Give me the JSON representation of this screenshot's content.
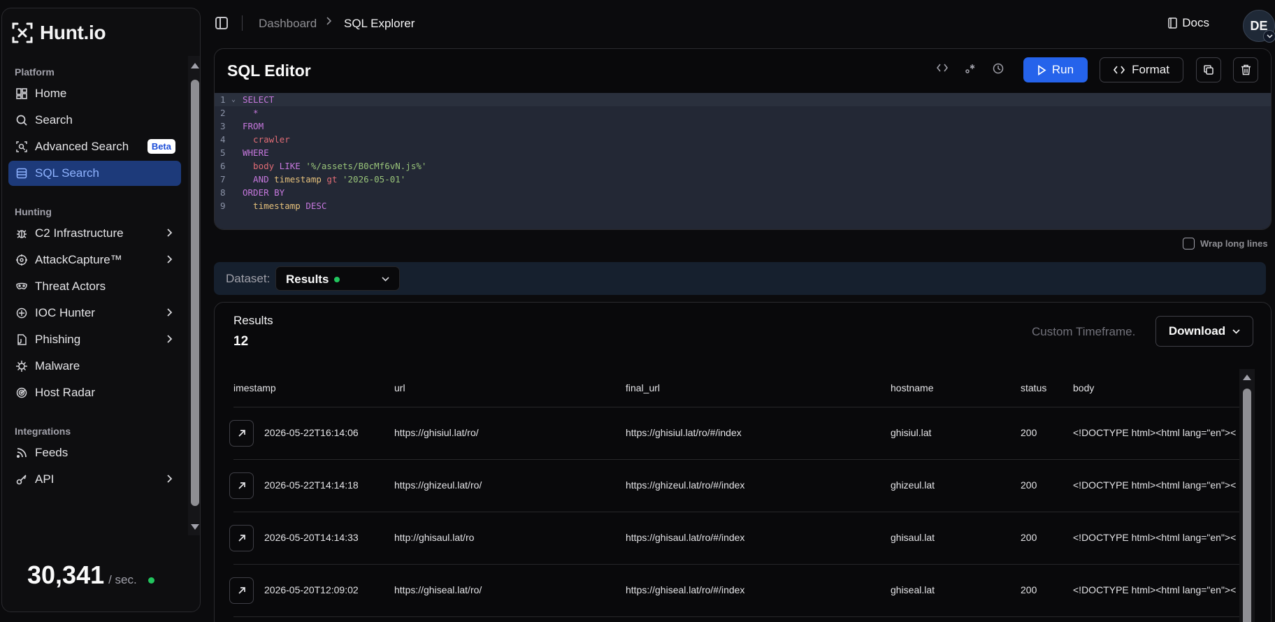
{
  "brand": {
    "name": "Hunt.io"
  },
  "sidebar": {
    "sections": [
      {
        "title": "Platform"
      },
      {
        "title": "Hunting"
      },
      {
        "title": "Integrations"
      }
    ],
    "platform_items": [
      {
        "label": "Home",
        "icon": "dashboard-icon"
      },
      {
        "label": "Search",
        "icon": "search-icon"
      },
      {
        "label": "Advanced Search",
        "icon": "scan-search-icon",
        "badge": "Beta"
      },
      {
        "label": "SQL Search",
        "icon": "database-icon",
        "active": true
      }
    ],
    "hunting_items": [
      {
        "label": "C2 Infrastructure",
        "icon": "bug-icon",
        "has_children": true
      },
      {
        "label": "AttackCapture™",
        "icon": "target-icon",
        "has_children": true
      },
      {
        "label": "Threat Actors",
        "icon": "mask-icon"
      },
      {
        "label": "IOC Hunter",
        "icon": "crosshair-icon",
        "has_children": true
      },
      {
        "label": "Phishing",
        "icon": "file-hook-icon",
        "has_children": true
      },
      {
        "label": "Malware",
        "icon": "virus-icon"
      },
      {
        "label": "Host Radar",
        "icon": "radar-icon"
      }
    ],
    "integration_items": [
      {
        "label": "Feeds",
        "icon": "rss-icon"
      },
      {
        "label": "API",
        "icon": "key-icon",
        "has_children": true
      }
    ],
    "rate": {
      "value": "30,341",
      "unit": "/ sec."
    }
  },
  "topbar": {
    "breadcrumb": [
      "Dashboard",
      "SQL Explorer"
    ],
    "docs_label": "Docs",
    "avatar_initials": "DE"
  },
  "editor": {
    "title": "SQL Editor",
    "run_label": "Run",
    "format_label": "Format",
    "lines": [
      {
        "n": "1",
        "tokens": [
          {
            "t": "SELECT",
            "c": "kw"
          }
        ]
      },
      {
        "n": "2",
        "tokens": [
          {
            "t": "  *",
            "c": "kw"
          }
        ]
      },
      {
        "n": "3",
        "tokens": [
          {
            "t": "FROM",
            "c": "kw"
          }
        ]
      },
      {
        "n": "4",
        "tokens": [
          {
            "t": "  crawler",
            "c": "id"
          }
        ]
      },
      {
        "n": "5",
        "tokens": [
          {
            "t": "WHERE",
            "c": "kw"
          }
        ]
      },
      {
        "n": "6",
        "tokens": [
          {
            "t": "  body",
            "c": "id"
          },
          {
            "t": " LIKE ",
            "c": "kw"
          },
          {
            "t": "'%/assets/B0cMf6vN.js%'",
            "c": "str"
          }
        ]
      },
      {
        "n": "7",
        "tokens": [
          {
            "t": "  AND ",
            "c": "kw"
          },
          {
            "t": "timestamp",
            "c": "tx"
          },
          {
            "t": " gt ",
            "c": "id"
          },
          {
            "t": "'2026-05-01'",
            "c": "str"
          }
        ]
      },
      {
        "n": "8",
        "tokens": [
          {
            "t": "ORDER BY",
            "c": "kw"
          }
        ]
      },
      {
        "n": "9",
        "tokens": [
          {
            "t": "  timestamp",
            "c": "tx"
          },
          {
            "t": " DESC",
            "c": "kw"
          }
        ]
      }
    ],
    "wrap_label": "Wrap long lines"
  },
  "dataset": {
    "label": "Dataset:",
    "value": "Results",
    "status_color": "#22c55e"
  },
  "results": {
    "title": "Results",
    "count": "12",
    "timeframe": "Custom Timeframe.",
    "download_label": "Download",
    "columns": [
      "imestamp",
      "url",
      "final_url",
      "hostname",
      "status",
      "body"
    ],
    "rows": [
      {
        "timestamp": "2026-05-22T16:14:06",
        "url": "https://ghisiul.lat/ro/",
        "final_url": "https://ghisiul.lat/ro/#/index",
        "hostname": "ghisiul.lat",
        "status": "200",
        "body": "<!DOCTYPE html><html lang=\"en\"><"
      },
      {
        "timestamp": "2026-05-22T14:14:18",
        "url": "https://ghizeul.lat/ro/",
        "final_url": "https://ghizeul.lat/ro/#/index",
        "hostname": "ghizeul.lat",
        "status": "200",
        "body": "<!DOCTYPE html><html lang=\"en\"><"
      },
      {
        "timestamp": "2026-05-20T14:14:33",
        "url": "http://ghisaul.lat/ro",
        "final_url": "https://ghisaul.lat/ro/#/index",
        "hostname": "ghisaul.lat",
        "status": "200",
        "body": "<!DOCTYPE html><html lang=\"en\"><"
      },
      {
        "timestamp": "2026-05-20T12:09:02",
        "url": "https://ghiseal.lat/ro/",
        "final_url": "https://ghiseal.lat/ro/#/index",
        "hostname": "ghiseal.lat",
        "status": "200",
        "body": "<!DOCTYPE html><html lang=\"en\"><"
      }
    ]
  },
  "colors": {
    "accent": "#2563eb",
    "active_bg": "#1d3a7a",
    "active_text": "#8fb3ff",
    "online": "#22c55e"
  }
}
